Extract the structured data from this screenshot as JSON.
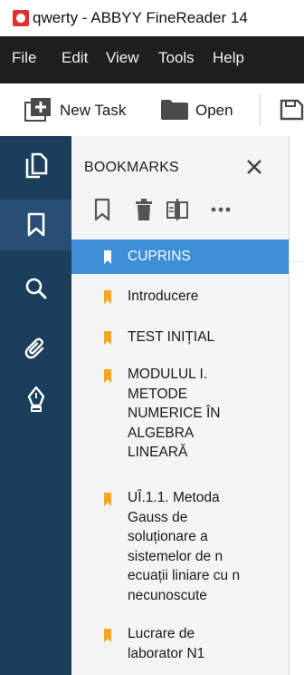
{
  "window": {
    "title": "qwerty - ABBYY FineReader 14"
  },
  "menu": [
    "File",
    "Edit",
    "View",
    "Tools",
    "Help"
  ],
  "toolbar": {
    "new_task": "New Task",
    "open": "Open"
  },
  "rail": [
    {
      "icon": "pages-icon"
    },
    {
      "icon": "bookmark-icon",
      "active": true
    },
    {
      "icon": "search-icon"
    },
    {
      "icon": "paperclip-icon"
    },
    {
      "icon": "pen-icon"
    }
  ],
  "panel": {
    "title": "BOOKMARKS",
    "tools": [
      "bookmark-outline-icon",
      "delete-icon",
      "split-icon",
      "more-icon"
    ],
    "bookmarks": [
      {
        "lines": [
          "CUPRINS"
        ],
        "selected": true
      },
      {
        "lines": [
          "Introducere"
        ]
      },
      {
        "lines": [
          "TEST INIȚIAL"
        ]
      },
      {
        "lines": [
          "MODULUL I.",
          "METODE",
          "NUMERICE ÎN",
          "ALGEBRA",
          "LINEARĂ"
        ]
      },
      {
        "lines": [
          "UÎ.1.1. Metoda",
          "Gauss de",
          "soluționare a",
          "sistemelor de n",
          "ecuații liniare cu n",
          "necunoscute"
        ]
      },
      {
        "lines": [
          "Lucrare de",
          "laborator N1"
        ]
      }
    ]
  },
  "colors": {
    "rail": "#1a3e5c",
    "rail_active": "#274f73",
    "selected": "#3d8fd8",
    "flag": "#f5a623",
    "menubar": "#1f1f1f"
  }
}
